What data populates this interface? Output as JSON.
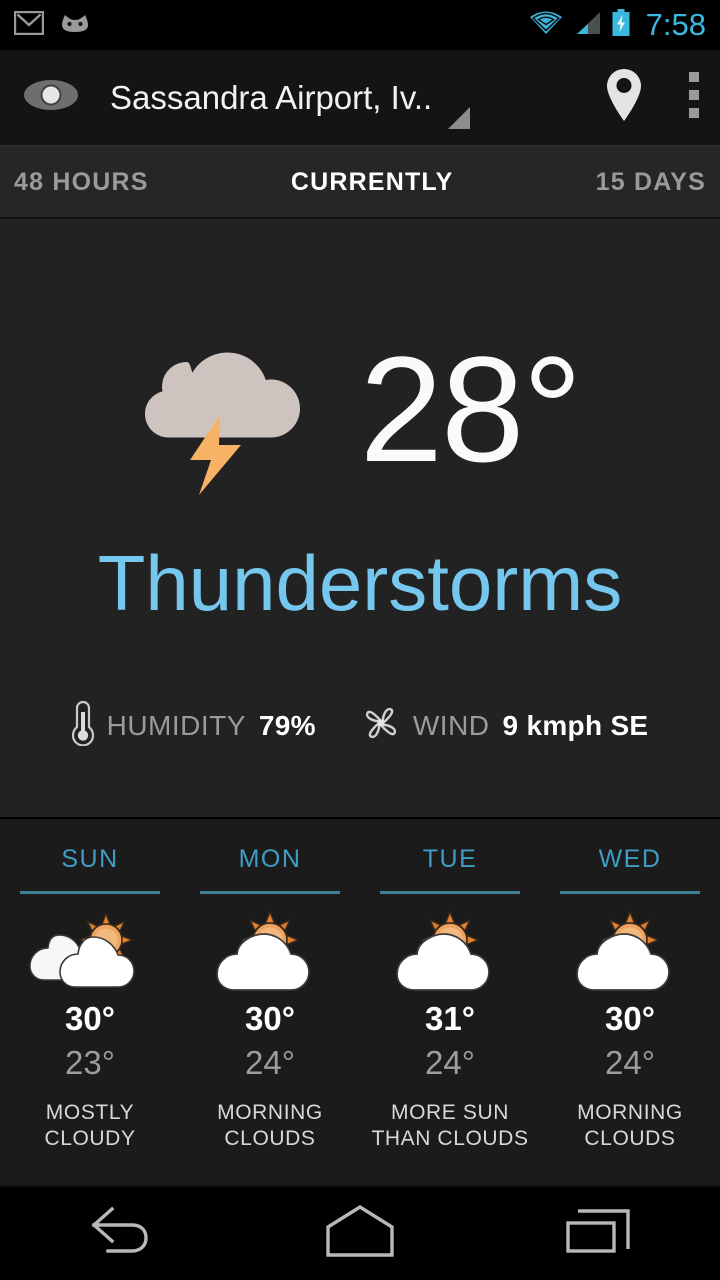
{
  "status_bar": {
    "notifications": [
      "gmail-icon",
      "android-robot-icon"
    ],
    "icons": [
      "wifi-icon",
      "cell-signal-icon",
      "battery-charging-icon"
    ],
    "clock": "7:58",
    "accent_color": "#3bb8e0"
  },
  "action_bar": {
    "app_icon": "eye-icon",
    "title": "Sassandra Airport, Iv..",
    "spinner_caret": "dropdown-triangle",
    "location_icon": "map-pin-icon",
    "overflow_icon": "overflow-menu-icon"
  },
  "tabs": [
    {
      "label": "48 HOURS",
      "selected": false
    },
    {
      "label": "CURRENTLY",
      "selected": true
    },
    {
      "label": "15 DAYS",
      "selected": false
    }
  ],
  "current": {
    "icon": "thunderstorm-icon",
    "temperature": "28°",
    "condition": "Thunderstorms",
    "condition_color": "#76c7ee",
    "humidity_label": "HUMIDITY",
    "humidity_value": "79%",
    "humidity_icon": "thermometer-icon",
    "wind_label": "WIND",
    "wind_value": "9 kmph SE",
    "wind_icon": "windmill-icon"
  },
  "forecast": [
    {
      "day": "SUN",
      "icon": "mostly-cloudy-icon",
      "high": "30°",
      "low": "23°",
      "desc": "MOSTLY\nCLOUDY"
    },
    {
      "day": "MON",
      "icon": "sun-behind-cloud-icon",
      "high": "30°",
      "low": "24°",
      "desc": "MORNING\nCLOUDS"
    },
    {
      "day": "TUE",
      "icon": "sun-behind-cloud-icon",
      "high": "31°",
      "low": "24°",
      "desc": "MORE SUN\nTHAN CLOUDS"
    },
    {
      "day": "WED",
      "icon": "sun-behind-cloud-icon",
      "high": "30°",
      "low": "24°",
      "desc": "MORNING\nCLOUDS"
    }
  ],
  "nav_bar": {
    "back": "back-icon",
    "home": "home-icon",
    "recents": "recent-apps-icon"
  }
}
